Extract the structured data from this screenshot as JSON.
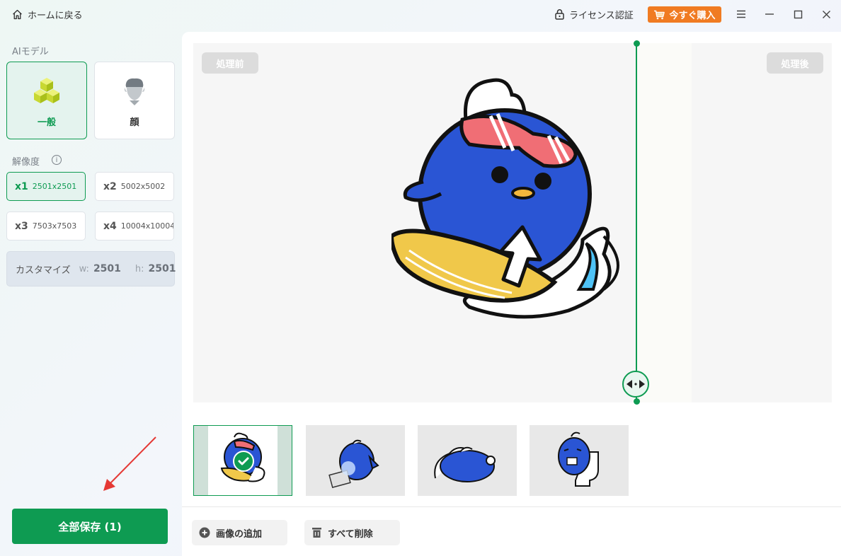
{
  "titlebar": {
    "home_label": "ホームに戻る",
    "license_label": "ライセンス認証",
    "buy_label": "今すぐ購入",
    "buy_color": "#f07b22"
  },
  "sidebar": {
    "ai_model_label": "AIモデル",
    "models": [
      {
        "label": "一般",
        "icon": "cubes-icon",
        "active": true
      },
      {
        "label": "顔",
        "icon": "face-icon",
        "active": false
      }
    ],
    "resolution_label": "解像度",
    "resolutions": [
      {
        "scale": "x1",
        "size": "2501x2501",
        "active": true
      },
      {
        "scale": "x2",
        "size": "5002x5002",
        "active": false
      },
      {
        "scale": "x3",
        "size": "7503x7503",
        "active": false
      },
      {
        "scale": "x4",
        "size": "10004x10004",
        "active": false
      }
    ],
    "customize": {
      "label": "カスタマイズ",
      "w_label": "w:",
      "w_value": "2501",
      "h_label": "h:",
      "h_value": "2501"
    },
    "save_all_label": "全部保存 (1)"
  },
  "preview": {
    "before_label": "処理前",
    "after_label": "処理後",
    "split_position_fraction": 0.69
  },
  "thumbnails": [
    {
      "name": "penguin-surfing",
      "selected": true
    },
    {
      "name": "penguin-laptop",
      "selected": false
    },
    {
      "name": "penguin-lying",
      "selected": false
    },
    {
      "name": "penguin-toilet",
      "selected": false
    }
  ],
  "actions": {
    "add_image_label": "画像の追加",
    "delete_all_label": "すべて削除"
  },
  "colors": {
    "accent": "#0e9b52",
    "buy": "#f07b22",
    "penguin_blue": "#2a55d4"
  }
}
